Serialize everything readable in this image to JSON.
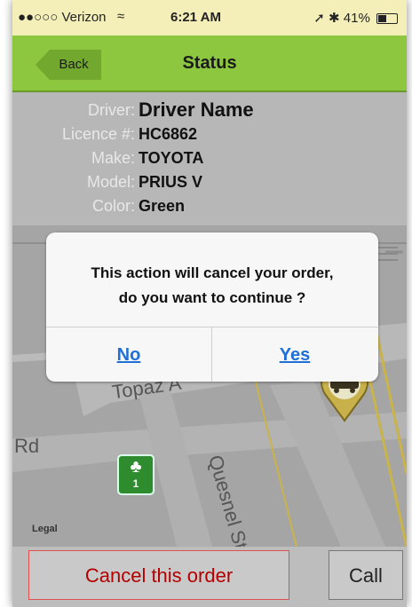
{
  "status_bar": {
    "carrier": "●●○○○ Verizon",
    "wifi": "wifi",
    "time": "6:21 AM",
    "battery": "41%"
  },
  "nav": {
    "back": "Back",
    "title": "Status"
  },
  "driver": {
    "rows": [
      {
        "label": "Driver:",
        "value": "Driver Name"
      },
      {
        "label": "Licence #:",
        "value": "HC6862"
      },
      {
        "label": "Make:",
        "value": "TOYOTA"
      },
      {
        "label": "Model:",
        "value": "PRIUS V"
      },
      {
        "label": "Color:",
        "value": "Green"
      }
    ]
  },
  "map": {
    "street1": "Topaz A",
    "street2": "Rd",
    "street3": "Quesnel St",
    "route_badge": "1",
    "legal": "Legal"
  },
  "dialog": {
    "line1": "This action will cancel your order,",
    "line2": "do you want to continue ?",
    "no": "No",
    "yes": "Yes"
  },
  "bottom": {
    "cancel": "Cancel this order",
    "call": "Call"
  }
}
